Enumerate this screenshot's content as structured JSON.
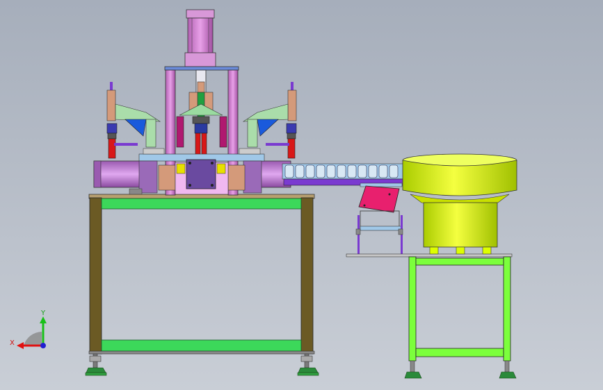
{
  "viewport": {
    "background_top": "#a6aebb",
    "background_bottom": "#c9ced6"
  },
  "triad": {
    "x_label": "X",
    "y_label": "Y",
    "x_color": "#e01010",
    "y_color": "#18c018",
    "z_color": "#2020d0"
  },
  "colors": {
    "frame_post": "#6b5a24",
    "frame_beam": "#3cd85a",
    "stand_frame": "#7cff3c",
    "cylinder": "#cc66cc",
    "bracket": "#aaddaa",
    "hopper": "#ddff00",
    "pink_chute": "#e8206e",
    "track": "#7a3ad0",
    "blue_wedge": "#1a5adc",
    "red_actuator": "#d81818",
    "tan_block": "#d49a7a",
    "purple_block": "#9a6ab8",
    "light_blue_parts": "#a0c8e8",
    "foot": "#2a8a3a"
  }
}
